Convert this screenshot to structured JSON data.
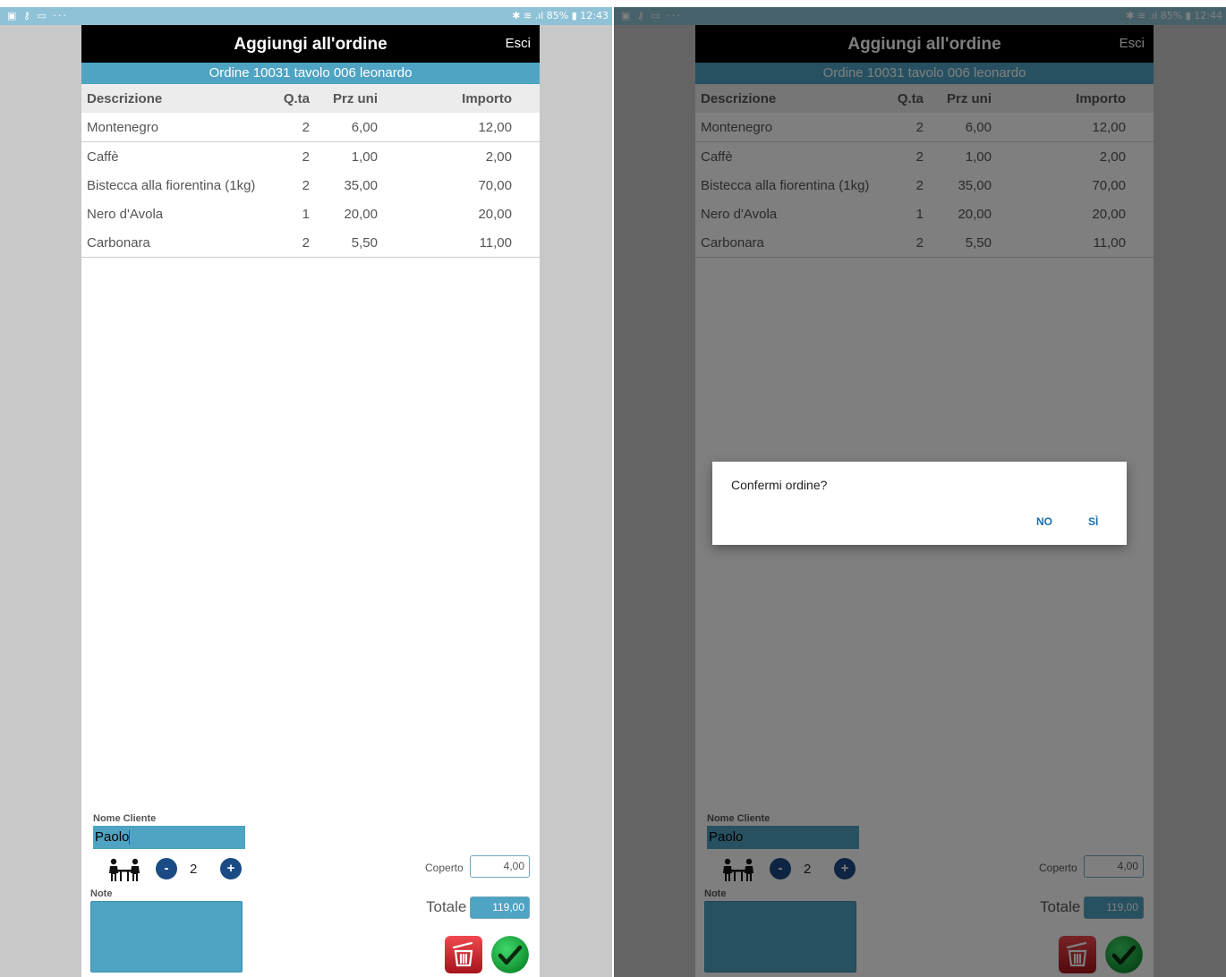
{
  "screens": [
    {
      "status": {
        "left_icons": "▣ ⚷ ▭ ···",
        "right_text": "✱ ≋ .ıl 85% ▮ 12:43"
      },
      "title": "Aggiungi all'ordine",
      "exit_label": "Esci",
      "order_label": "Ordine 10031 tavolo 006 leonardo",
      "columns": [
        "Descrizione",
        "Q.ta",
        "Prz uni",
        "Importo"
      ],
      "rows": [
        {
          "desc": "Montenegro",
          "qty": "2",
          "price": "6,00",
          "amount": "12,00"
        },
        {
          "desc": "Caffè",
          "qty": "2",
          "price": "1,00",
          "amount": "2,00"
        },
        {
          "desc": "Bistecca alla fiorentina (1kg)",
          "qty": "2",
          "price": "35,00",
          "amount": "70,00"
        },
        {
          "desc": "Nero d'Avola",
          "qty": "1",
          "price": "20,00",
          "amount": "20,00"
        },
        {
          "desc": "Carbonara",
          "qty": "2",
          "price": "5,50",
          "amount": "11,00"
        }
      ],
      "customer_label": "Nome Cliente",
      "customer_value": "Paolo",
      "minus": "-",
      "plus": "+",
      "covers": "2",
      "note_label": "Note",
      "coperto_label": "Coperto",
      "coperto_value": "4,00",
      "totale_label": "Totale",
      "totale_value": "119,00"
    },
    {
      "status": {
        "left_icons": "▣ ⚷ ▭ ···",
        "right_text": "✱ ≋ .ıl 85% ▮ 12:44"
      },
      "title": "Aggiungi all'ordine",
      "exit_label": "Esci",
      "order_label": "Ordine 10031 tavolo 006 leonardo",
      "columns": [
        "Descrizione",
        "Q.ta",
        "Prz uni",
        "Importo"
      ],
      "rows": [
        {
          "desc": "Montenegro",
          "qty": "2",
          "price": "6,00",
          "amount": "12,00"
        },
        {
          "desc": "Caffè",
          "qty": "2",
          "price": "1,00",
          "amount": "2,00"
        },
        {
          "desc": "Bistecca alla fiorentina (1kg)",
          "qty": "2",
          "price": "35,00",
          "amount": "70,00"
        },
        {
          "desc": "Nero d'Avola",
          "qty": "1",
          "price": "20,00",
          "amount": "20,00"
        },
        {
          "desc": "Carbonara",
          "qty": "2",
          "price": "5,50",
          "amount": "11,00"
        }
      ],
      "customer_label": "Nome Cliente",
      "customer_value": "Paolo",
      "minus": "-",
      "plus": "+",
      "covers": "2",
      "note_label": "Note",
      "coperto_label": "Coperto",
      "coperto_value": "4,00",
      "totale_label": "Totale",
      "totale_value": "119,00",
      "dialog": {
        "message": "Confermi ordine?",
        "no": "NO",
        "si": "SÌ"
      }
    }
  ],
  "icons": {
    "covers": "diners-at-table-icon",
    "delete": "trash-icon",
    "confirm": "checkmark-icon"
  },
  "colors": {
    "accent": "#4fa3c3",
    "stepper": "#1a4b85",
    "delete": "#d9272e",
    "confirm": "#22b14c",
    "dialog_button": "#1b6fb0"
  }
}
